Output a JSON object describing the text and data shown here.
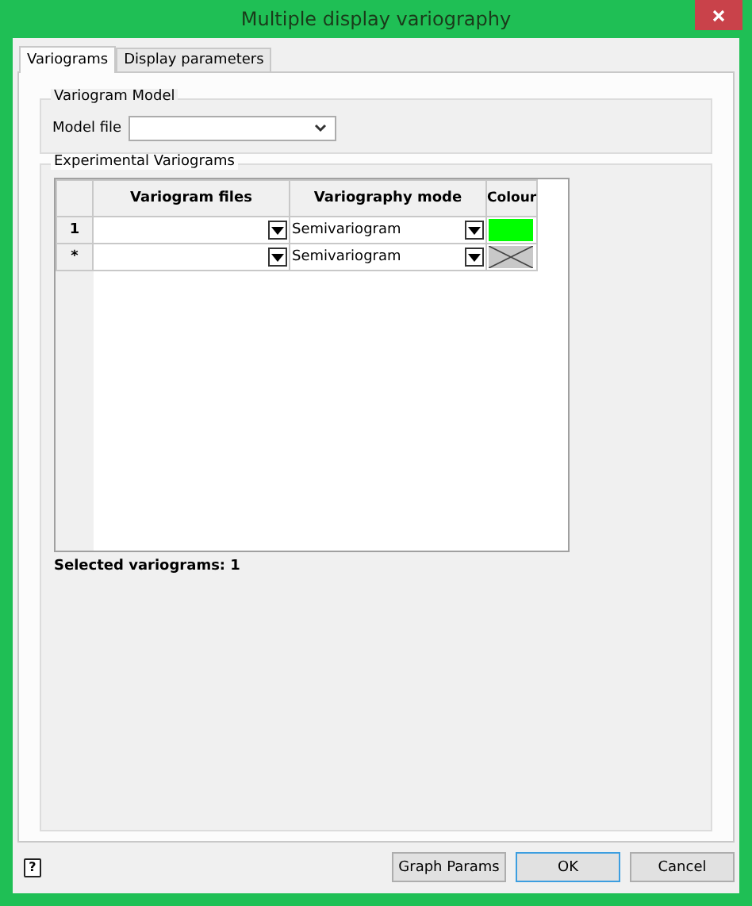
{
  "window": {
    "title": "Multiple display variography"
  },
  "tabs": [
    {
      "label": "Variograms",
      "selected": true
    },
    {
      "label": "Display parameters",
      "selected": false
    }
  ],
  "variogram_model": {
    "title": "Variogram Model",
    "model_file": {
      "label": "Model file"
    }
  },
  "experimental_variograms": {
    "title": "Experimental Variograms",
    "table": {
      "columns": [
        "Variogram files",
        "Variography mode",
        "Colour"
      ],
      "rows": [
        {
          "header": "1",
          "mode": "Semivariogram",
          "kind": "swatch",
          "color": "#00ff00"
        },
        {
          "header": "*",
          "mode": "Semivariogram",
          "kind": "none"
        }
      ]
    },
    "selected_count": "Selected variograms: 1"
  },
  "help_button": "?",
  "buttons": [
    "Graph Params",
    "OK",
    "Cancel"
  ]
}
